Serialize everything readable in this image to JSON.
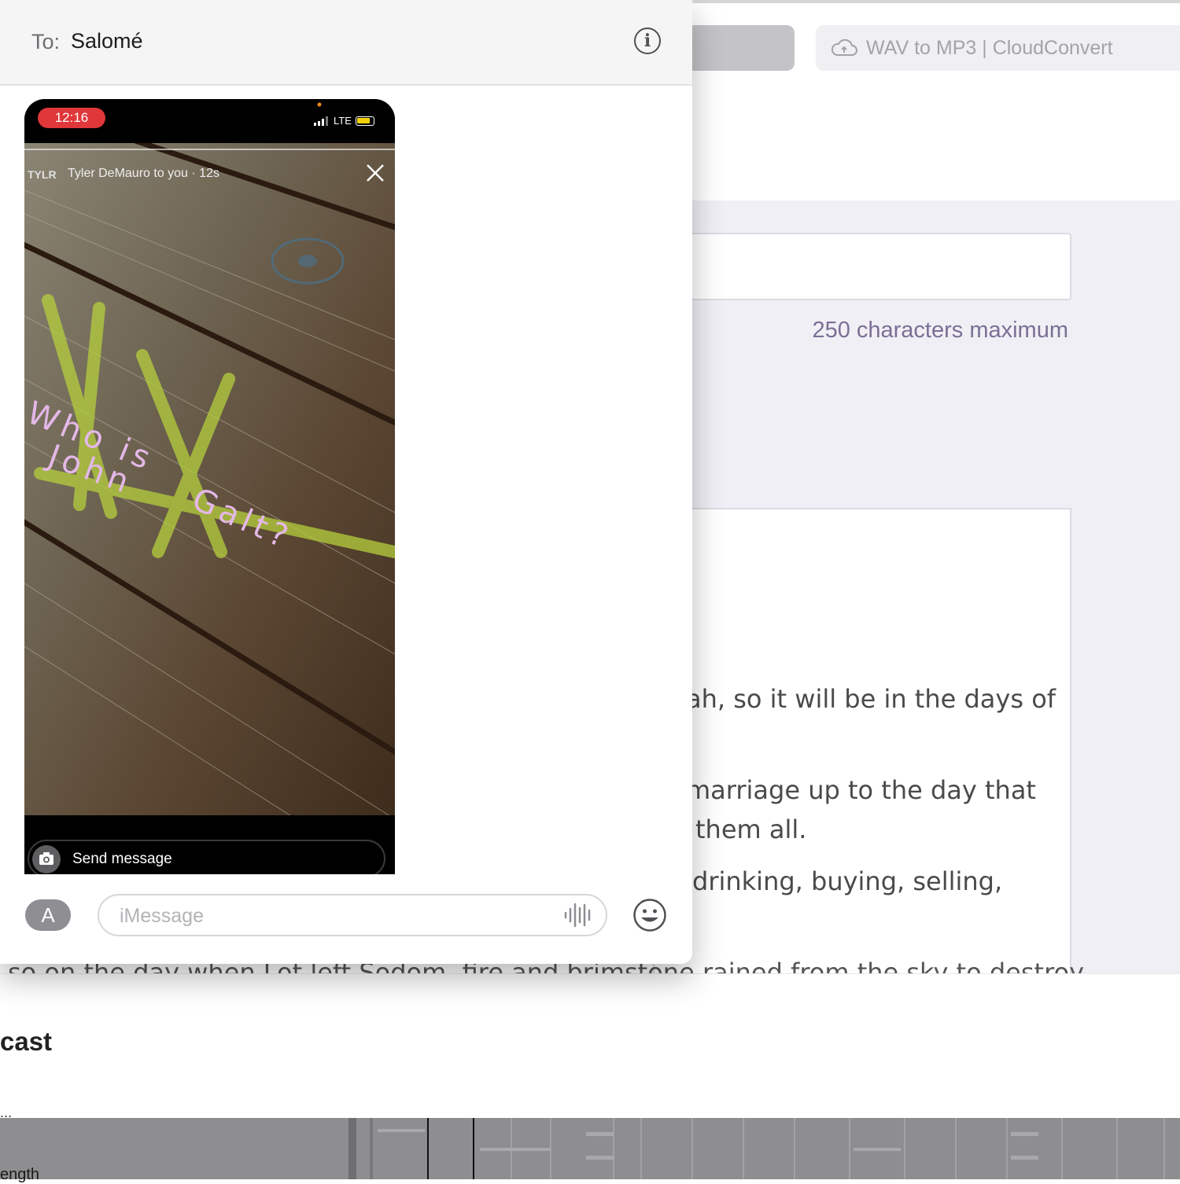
{
  "browser": {
    "tab_title": "WAV to MP3 | CloudConvert",
    "char_limit_hint": "250 characters maximum",
    "description_lines": [
      "ah, so it will be in the days of",
      "marriage up to the day that",
      "them all.",
      "drinking, buying, selling,",
      "so on the day when Lot left Sodom, fire and brimstone rained from the sky to destroy"
    ],
    "lower_label": "cast",
    "dots": "...",
    "track_label": "ength"
  },
  "messages": {
    "to_label": "To:",
    "recipient": "Salomé",
    "attachment": {
      "status_time": "12:16",
      "network": "LTE",
      "story_user": "TYLR",
      "story_meta": "Tyler DeMauro to you · 12s",
      "scribble_line1": "Who is",
      "scribble_line2": "John",
      "scribble_line3": "Galt?",
      "reply_placeholder": "Send message"
    },
    "compose_placeholder": "iMessage",
    "apps_icon_glyph": "A"
  },
  "colors": {
    "accent_red": "#e0373a",
    "battery_yellow": "#f3d10a",
    "scribble_pink": "#e4b8e8",
    "hint_purple": "#7b6f95"
  }
}
